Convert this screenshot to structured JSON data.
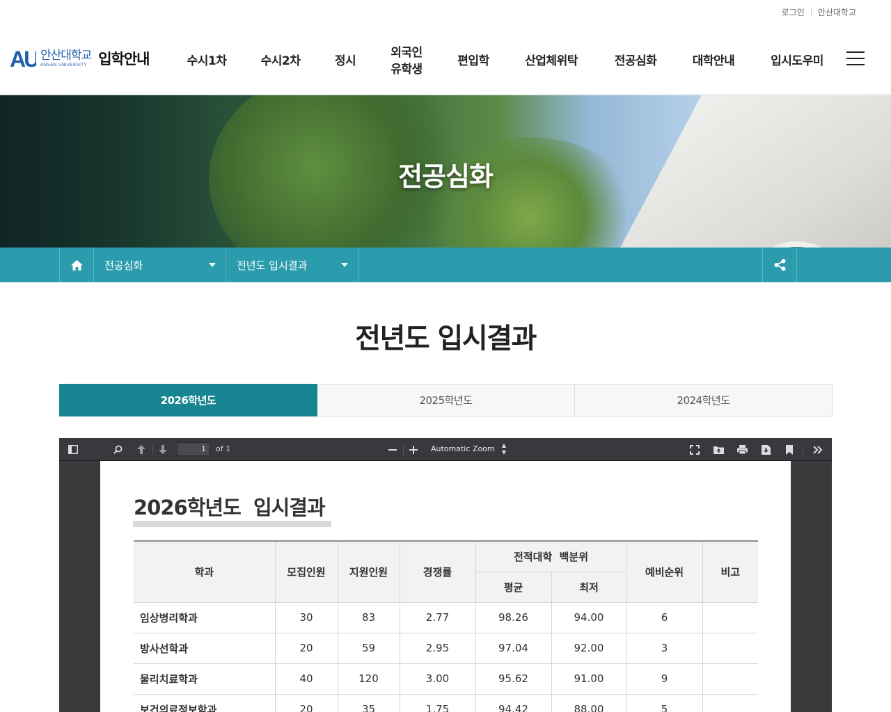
{
  "util": {
    "login": "로그인",
    "university": "안산대학교"
  },
  "logo": {
    "kr": "안산대학교",
    "en": "ANSAN UNIVERSITY",
    "mark": "AU",
    "title": "입학안내"
  },
  "gnb": [
    "수시1차",
    "수시2차",
    "정시",
    "외국인 유학생",
    "편입학",
    "산업체위탁",
    "전공심화",
    "대학안내",
    "입시도우미"
  ],
  "hero": {
    "title": "전공심화"
  },
  "location": {
    "menu1": "전공심화",
    "menu2": "전년도 입시결과",
    "icons": [
      "home-icon",
      "share-icon"
    ]
  },
  "page": {
    "title": "전년도 입시결과"
  },
  "tabs": [
    {
      "label": "2026학년도",
      "active": true
    },
    {
      "label": "2025학년도",
      "active": false
    },
    {
      "label": "2024학년도",
      "active": false
    }
  ],
  "viewer": {
    "page_number": "1",
    "page_count": "of 1",
    "zoom": "Automatic Zoom",
    "icons": [
      "sidebar-toggle-icon",
      "find-icon",
      "previous-page-icon",
      "next-page-icon",
      "zoom-out-icon",
      "zoom-in-icon",
      "presentation-mode-icon",
      "open-file-icon",
      "print-icon",
      "download-icon",
      "bookmark-icon",
      "tools-icon"
    ]
  },
  "document": {
    "title": "2026학년도  입시결과",
    "headers": {
      "dept": "학과",
      "quota": "모집인원",
      "applicants": "지원인원",
      "ratio": "경쟁률",
      "grade_group": "전적대학  백분위",
      "avg": "평균",
      "min": "최저",
      "waitlist": "예비순위",
      "note": "비고"
    },
    "rows": [
      {
        "dept": "임상병리학과",
        "quota": "30",
        "applicants": "83",
        "ratio": "2.77",
        "avg": "98.26",
        "min": "94.00",
        "waitlist": "6",
        "note": ""
      },
      {
        "dept": "방사선학과",
        "quota": "20",
        "applicants": "59",
        "ratio": "2.95",
        "avg": "97.04",
        "min": "92.00",
        "waitlist": "3",
        "note": ""
      },
      {
        "dept": "물리치료학과",
        "quota": "40",
        "applicants": "120",
        "ratio": "3.00",
        "avg": "95.62",
        "min": "91.00",
        "waitlist": "9",
        "note": ""
      },
      {
        "dept": "보건의료정보학과",
        "quota": "20",
        "applicants": "35",
        "ratio": "1.75",
        "avg": "94.42",
        "min": "88.00",
        "waitlist": "5",
        "note": ""
      }
    ]
  },
  "colors": {
    "teal_bar": "#2b9cad",
    "tab_active": "#168591",
    "logo_blue": "#1f5fae"
  }
}
